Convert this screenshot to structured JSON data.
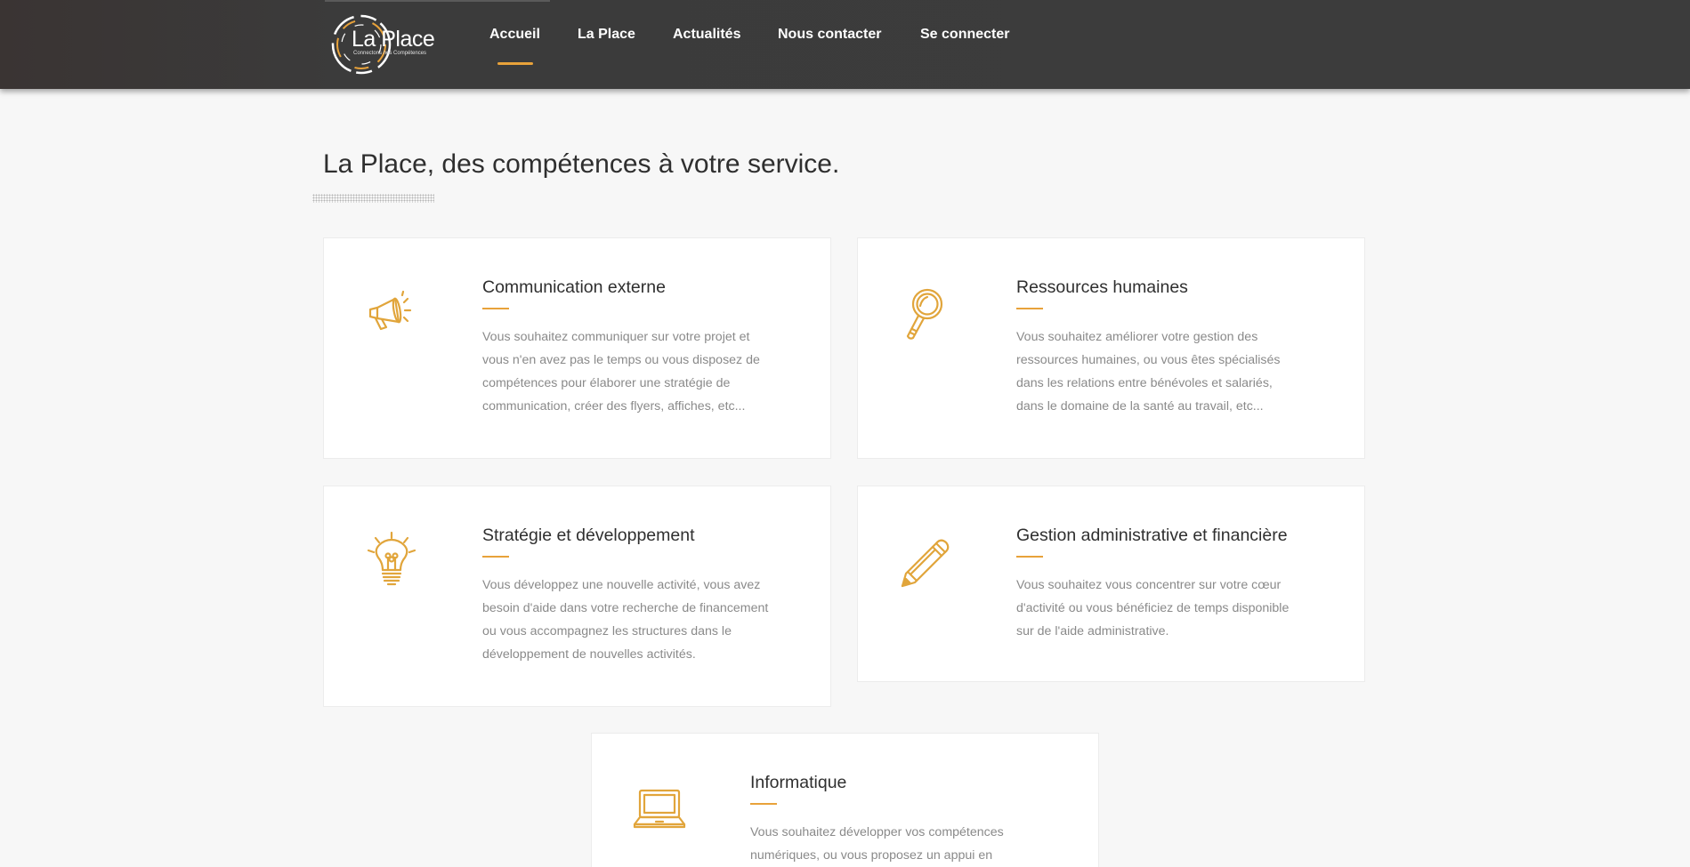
{
  "header": {
    "logo": {
      "text": "La Place",
      "tagline": "Connectons nos Compétences"
    },
    "nav": [
      {
        "label": "Accueil",
        "active": true
      },
      {
        "label": "La Place",
        "active": false
      },
      {
        "label": "Actualités",
        "active": false
      },
      {
        "label": "Nous contacter",
        "active": false
      },
      {
        "label": "Se connecter",
        "active": false
      }
    ]
  },
  "main": {
    "title": "La Place, des compétences à votre service.",
    "services": [
      {
        "icon": "megaphone-icon",
        "title": "Communication externe",
        "lines": [
          "Vous souhaitez communiquer sur votre projet et",
          "vous n'en avez pas le temps ou vous disposez de",
          "compétences pour élaborer une stratégie de",
          "communication, créer des flyers, affiches, etc..."
        ]
      },
      {
        "icon": "magnifier-icon",
        "title": "Ressources humaines",
        "lines": [
          "Vous souhaitez améliorer votre gestion des",
          "ressources humaines, ou vous êtes spécialisés",
          "dans les relations entre bénévoles et salariés,",
          "dans le domaine de la santé au travail, etc..."
        ]
      },
      {
        "icon": "lightbulb-icon",
        "title": "Stratégie et développement",
        "lines": [
          "Vous développez une nouvelle activité, vous avez",
          "besoin d'aide dans votre recherche de financement",
          "ou vous accompagnez les structures dans le",
          "développement de nouvelles activités."
        ]
      },
      {
        "icon": "pencil-icon",
        "title": "Gestion administrative et financière",
        "lines": [
          "Vous souhaitez vous concentrer sur votre cœur",
          "d'activité ou vous bénéficiez de temps disponible",
          "sur de l'aide administrative."
        ]
      },
      {
        "icon": "laptop-icon",
        "title": "Informatique",
        "lines": [
          "Vous souhaitez développer vos compétences",
          "numériques, ou vous proposez un appui en"
        ]
      }
    ]
  },
  "colors": {
    "accent": "#e8a23a",
    "header_bg": "#3c3c3c",
    "page_bg": "#f7f7f7"
  }
}
